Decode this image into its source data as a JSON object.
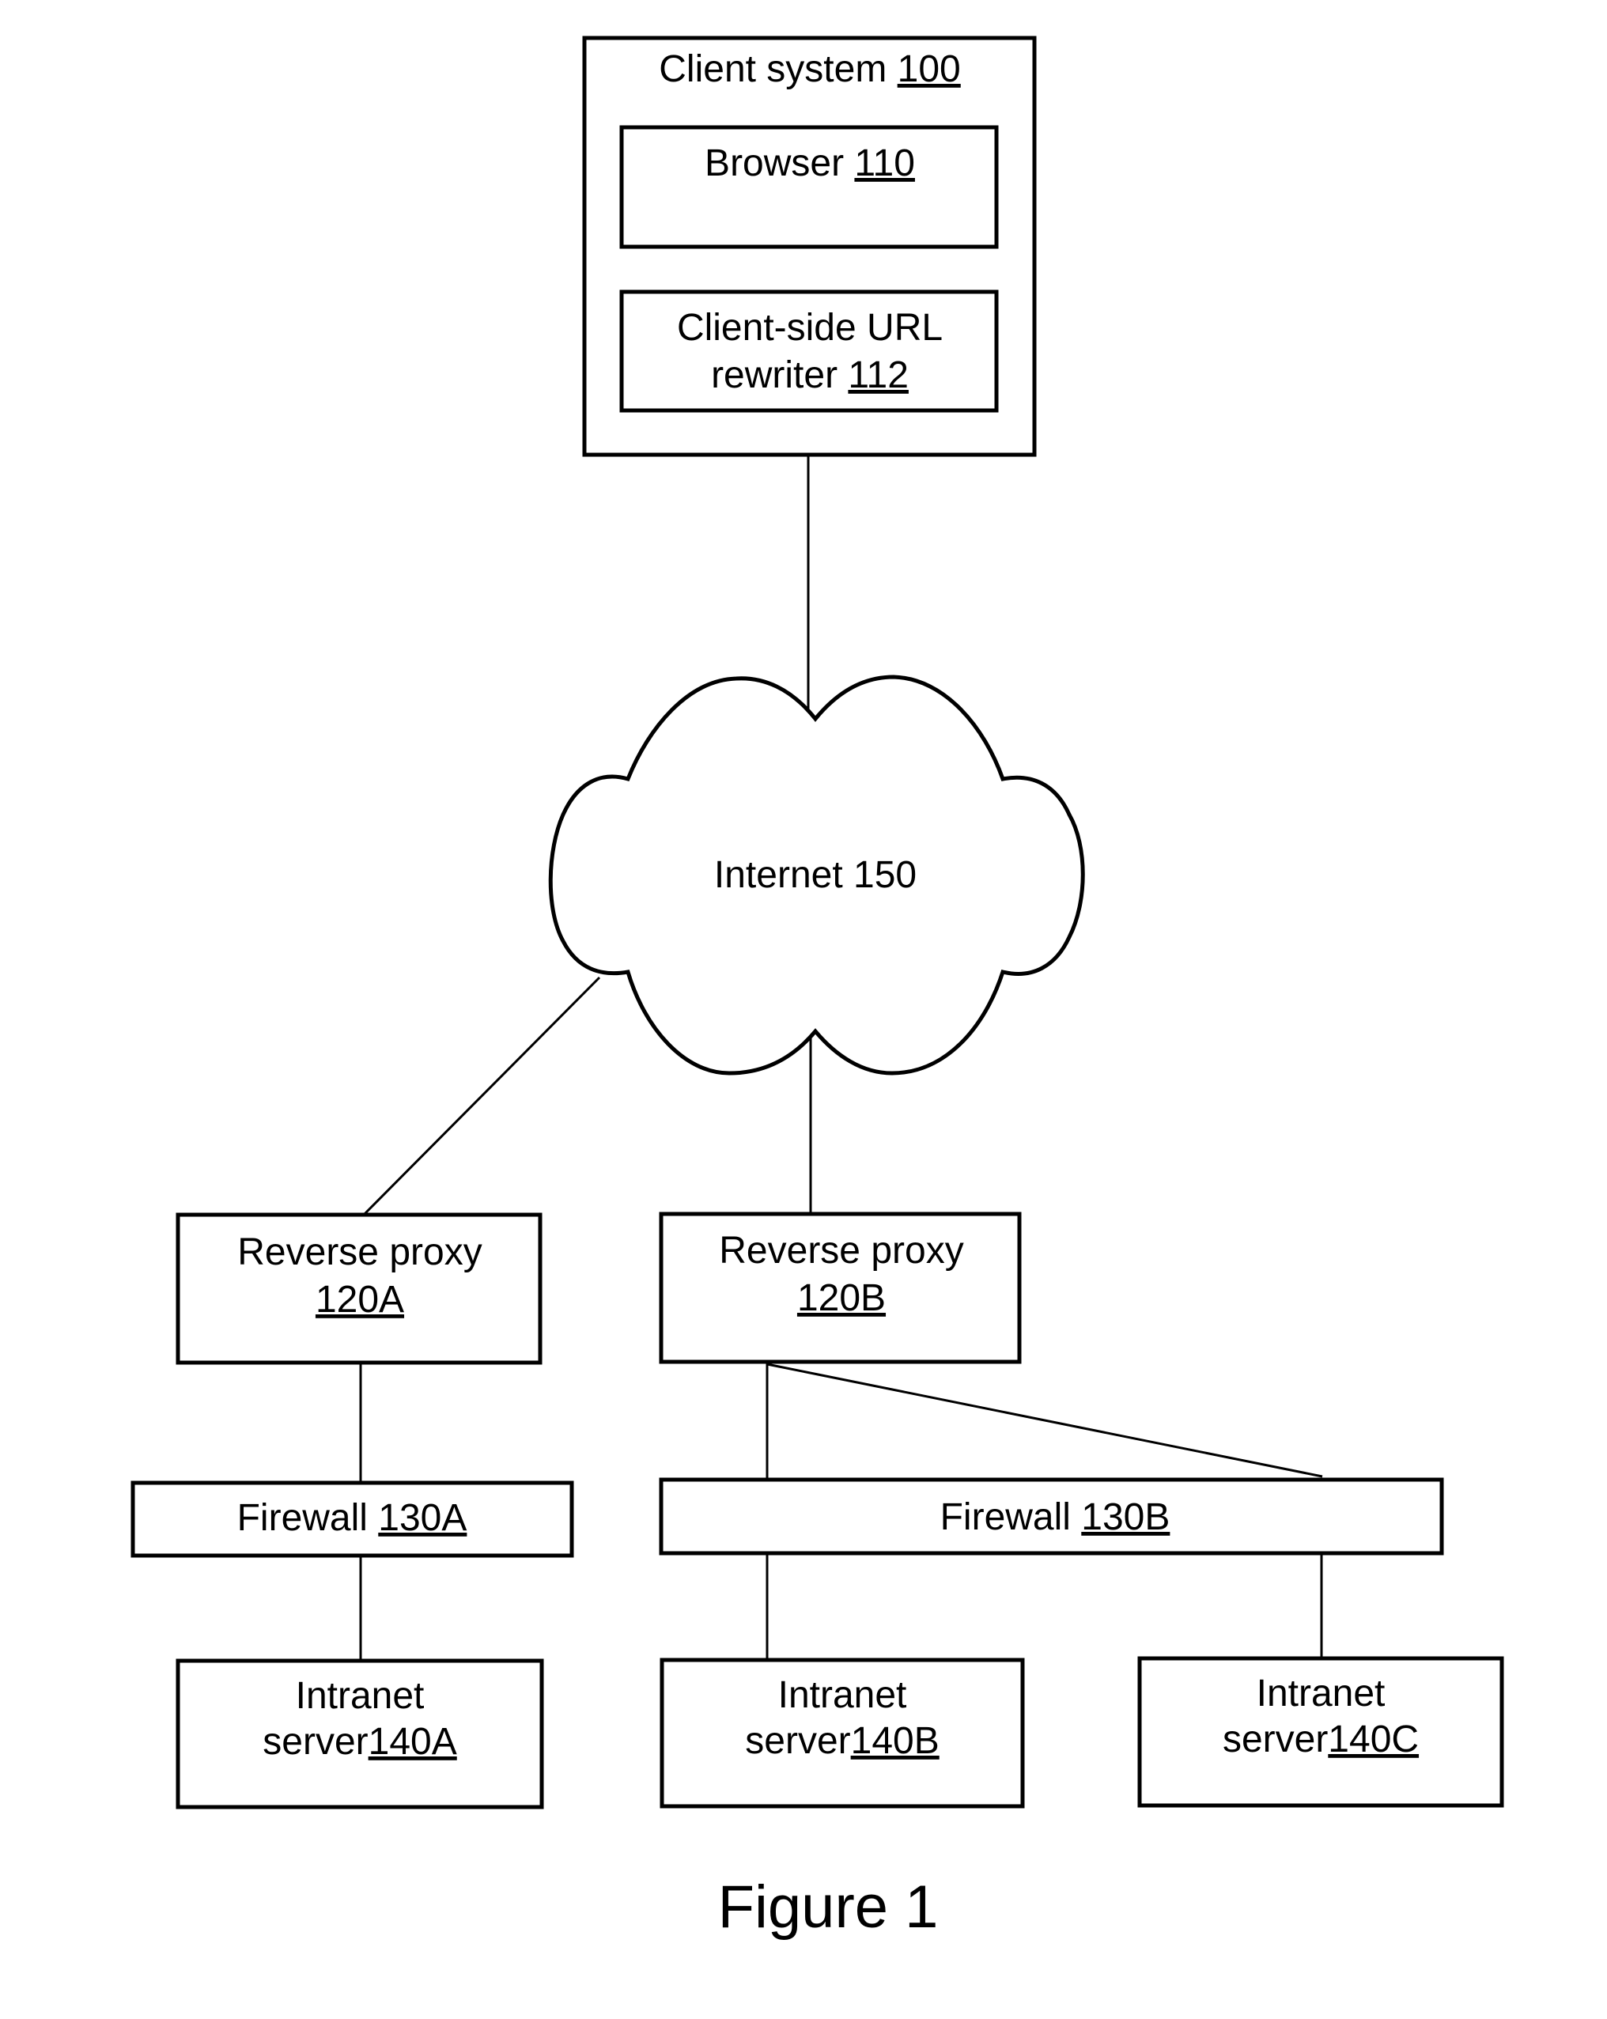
{
  "figure": {
    "caption": "Figure 1"
  },
  "nodes": {
    "client_system": {
      "label": "Client system ",
      "ref": "100"
    },
    "browser": {
      "label": "Browser ",
      "ref": "110"
    },
    "url_rewriter": {
      "line1": "Client-side URL",
      "label": "rewriter ",
      "ref": "112"
    },
    "internet": {
      "label": "Internet 150"
    },
    "proxy_a": {
      "line1": "Reverse proxy",
      "ref": "120A"
    },
    "proxy_b": {
      "line1": "Reverse proxy",
      "ref": "120B"
    },
    "firewall_a": {
      "label": "Firewall ",
      "ref": "130A"
    },
    "firewall_b": {
      "label": "Firewall ",
      "ref": "130B"
    },
    "server_a": {
      "line1": "Intranet",
      "label": "server",
      "ref": "140A"
    },
    "server_b": {
      "line1": "Intranet",
      "label": "server",
      "ref": "140B"
    },
    "server_c": {
      "line1": "Intranet",
      "label": "server",
      "ref": "140C"
    }
  },
  "edges": [
    [
      "client_system",
      "internet"
    ],
    [
      "internet",
      "proxy_a"
    ],
    [
      "internet",
      "proxy_b"
    ],
    [
      "proxy_a",
      "firewall_a"
    ],
    [
      "firewall_a",
      "server_a"
    ],
    [
      "proxy_b",
      "firewall_b"
    ],
    [
      "proxy_b",
      "server_c"
    ],
    [
      "firewall_b",
      "server_b"
    ],
    [
      "firewall_b",
      "server_c"
    ]
  ]
}
